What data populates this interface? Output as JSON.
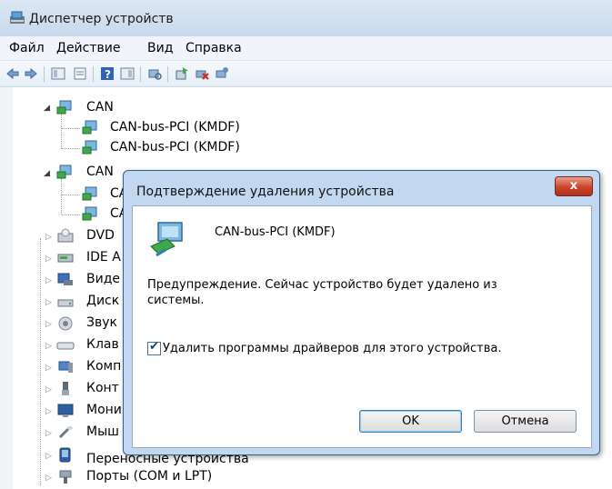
{
  "window": {
    "title": "Диспетчер устройств"
  },
  "menu": [
    "Файл",
    "Действие",
    "Вид",
    "Справка"
  ],
  "toolbar": {
    "icons": [
      "back-icon",
      "forward-icon",
      "console-tree-icon",
      "properties-icon",
      "help-icon",
      "view-icon",
      "scan-hardware-icon",
      "update-driver-icon",
      "uninstall-icon",
      "disable-icon"
    ]
  },
  "tree": {
    "nodes": [
      {
        "label": "CAN",
        "icon": "can-category-icon",
        "expanded": true
      },
      {
        "label": "CAN-bus-PCI (KMDF)",
        "icon": "can-device-icon"
      },
      {
        "label": "CAN-bus-PCI (KMDF)",
        "icon": "can-device-icon"
      },
      {
        "label": "CAN",
        "icon": "can-category-icon",
        "expanded": true
      },
      {
        "label": "CA",
        "icon": "can-device-icon"
      },
      {
        "label": "CA",
        "icon": "can-device-icon"
      },
      {
        "label": "DVD",
        "icon": "dvd-drive-icon"
      },
      {
        "label": "IDE A",
        "icon": "ide-controller-icon"
      },
      {
        "label": "Виде",
        "icon": "video-adapter-icon"
      },
      {
        "label": "Диск",
        "icon": "disk-drive-icon"
      },
      {
        "label": "Звук",
        "icon": "sound-icon"
      },
      {
        "label": "Клав",
        "icon": "keyboard-icon"
      },
      {
        "label": "Комп",
        "icon": "computer-icon"
      },
      {
        "label": "Конт",
        "icon": "usb-controller-icon"
      },
      {
        "label": "Мони",
        "icon": "monitor-icon"
      },
      {
        "label": "Мыш",
        "icon": "mouse-icon"
      },
      {
        "label": "Переносные устройства",
        "icon": "portable-device-icon"
      },
      {
        "label": "Порты (COM и LPT)",
        "icon": "ports-icon"
      }
    ]
  },
  "dialog": {
    "title": "Подтверждение удаления устройства",
    "close_label": "x",
    "device_name": "CAN-bus-PCI (KMDF)",
    "warning": "Предупреждение. Сейчас устройство будет удалено из системы.",
    "checkbox_label": "Удалить программы драйверов для этого устройства.",
    "checkbox_checked": true,
    "ok_label": "OK",
    "cancel_label": "Отмена"
  }
}
